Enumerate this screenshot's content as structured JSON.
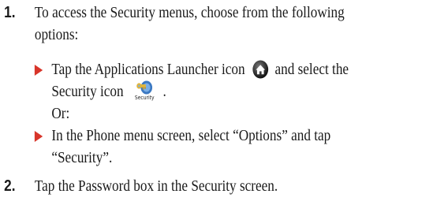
{
  "steps": [
    {
      "number": "1.",
      "lines": [
        "To access the Security menus, choose from the following",
        "options:"
      ],
      "options": [
        {
          "pre_icon1": "Tap the Applications Launcher icon",
          "icon1": "applications-launcher-icon",
          "post_icon1": "and select the",
          "pre_icon2": "Security icon",
          "icon2": "security-key-icon",
          "icon2_caption": "Security",
          "post_icon2": ".",
          "separator": "Or:"
        },
        {
          "line1": "In the Phone menu screen, select “Options” and tap",
          "line2": "“Security”."
        }
      ]
    },
    {
      "number": "2.",
      "lines": [
        "Tap the Password box in the Security screen."
      ]
    }
  ],
  "colors": {
    "bullet": "#d8352a",
    "text": "#1a1a1a"
  }
}
